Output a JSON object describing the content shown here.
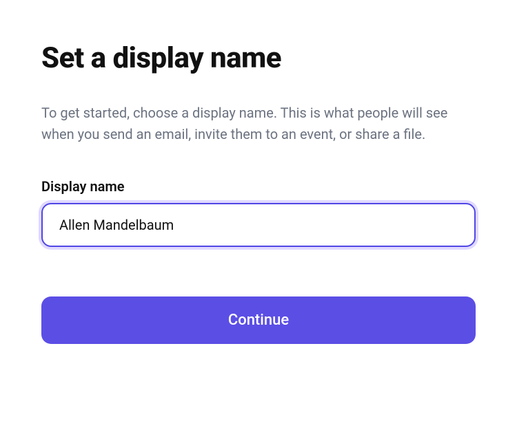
{
  "heading": "Set a display name",
  "description": "To get started, choose a display name. This is what people will see when you send an email, invite them to an event, or share a file.",
  "field": {
    "label": "Display name",
    "value": "Allen Mandelbaum"
  },
  "cta": {
    "label": "Continue"
  },
  "colors": {
    "accent": "#5b4ee5",
    "focusRing": "#e0d9ff",
    "textMuted": "#6b7280"
  }
}
